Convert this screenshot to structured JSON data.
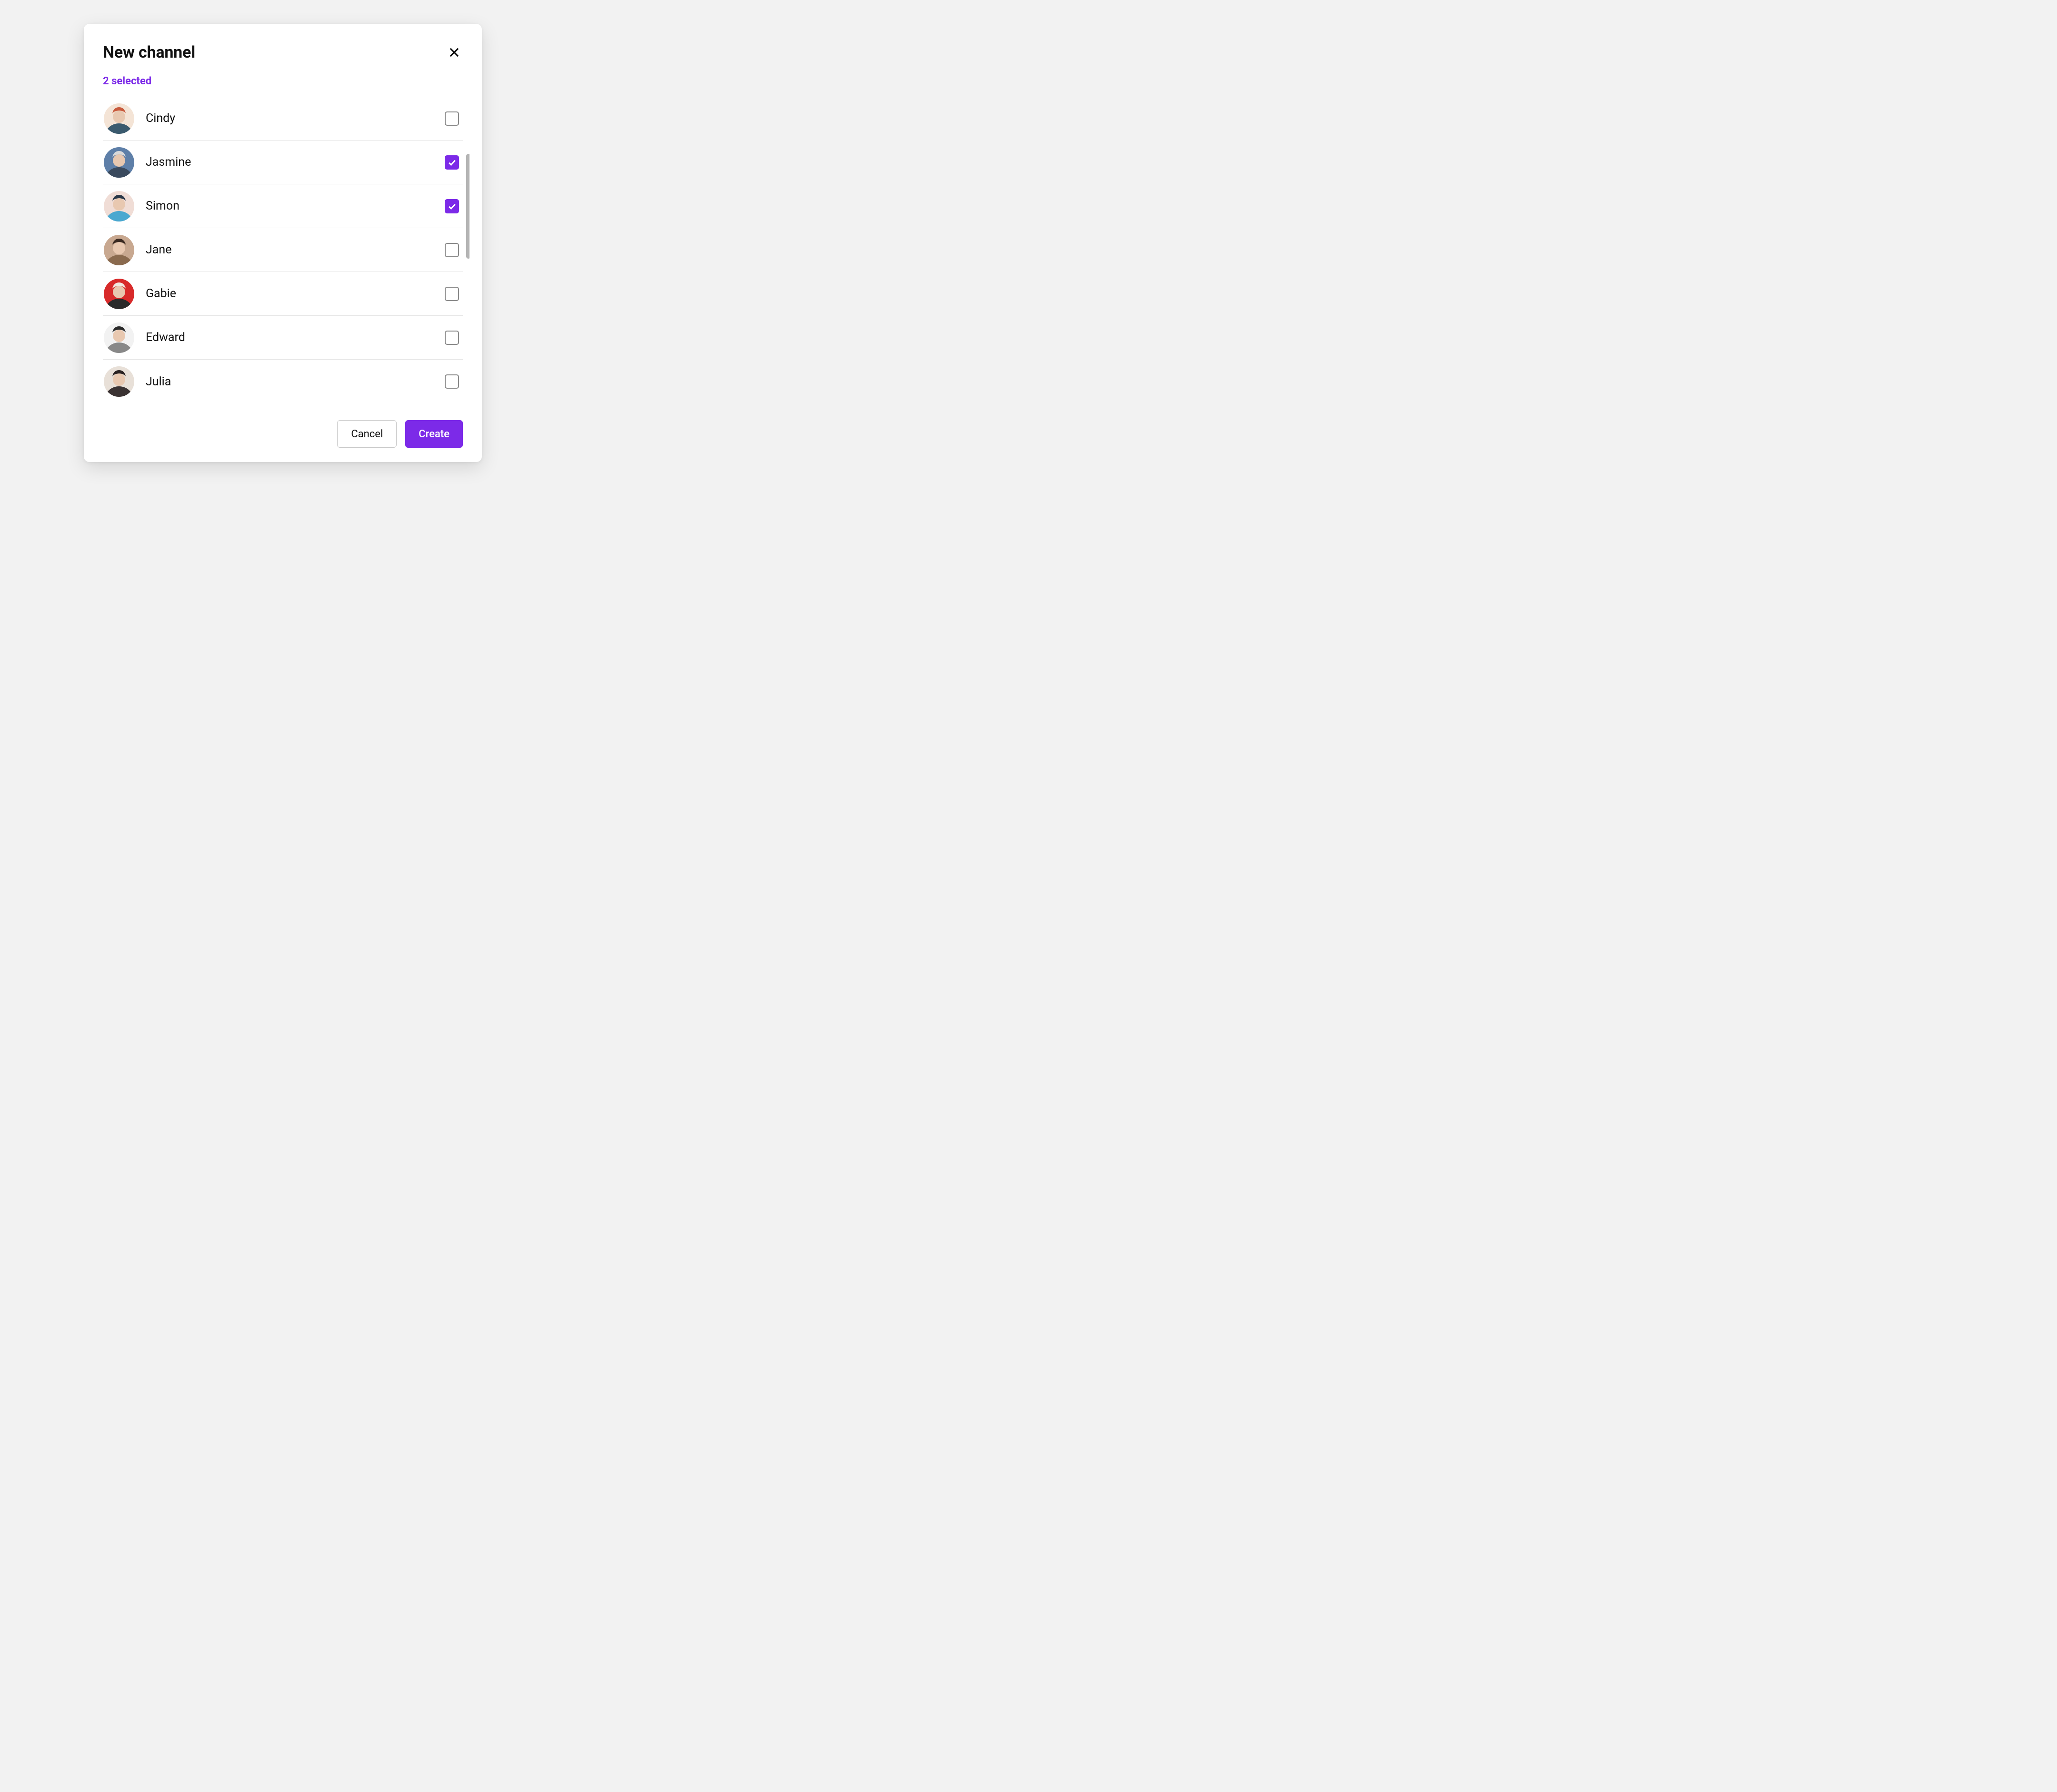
{
  "modal": {
    "title": "New channel",
    "selected_label": "2 selected",
    "cancel_label": "Cancel",
    "create_label": "Create"
  },
  "colors": {
    "accent": "#7c2ae8",
    "border": "#e5e5e5",
    "checkbox_border": "#8a8a8a"
  },
  "users": [
    {
      "name": "Cindy",
      "selected": false,
      "avatar_palette": [
        "#f4e4d6",
        "#c85a3c",
        "#3a5a6e"
      ]
    },
    {
      "name": "Jasmine",
      "selected": true,
      "avatar_palette": [
        "#5e7fa8",
        "#d9d9d9",
        "#3a4a5e"
      ]
    },
    {
      "name": "Simon",
      "selected": true,
      "avatar_palette": [
        "#f0ddd6",
        "#2a3848",
        "#4aa8d0"
      ]
    },
    {
      "name": "Jane",
      "selected": false,
      "avatar_palette": [
        "#c8a890",
        "#3a2a22",
        "#8a6a4e"
      ]
    },
    {
      "name": "Gabie",
      "selected": false,
      "avatar_palette": [
        "#d82a2a",
        "#f0e8e0",
        "#2a2a2a"
      ]
    },
    {
      "name": "Edward",
      "selected": false,
      "avatar_palette": [
        "#f2f2f2",
        "#2a2a2a",
        "#888888"
      ]
    },
    {
      "name": "Julia",
      "selected": false,
      "avatar_palette": [
        "#e8e0d8",
        "#2a2222",
        "#3a3232"
      ]
    }
  ]
}
